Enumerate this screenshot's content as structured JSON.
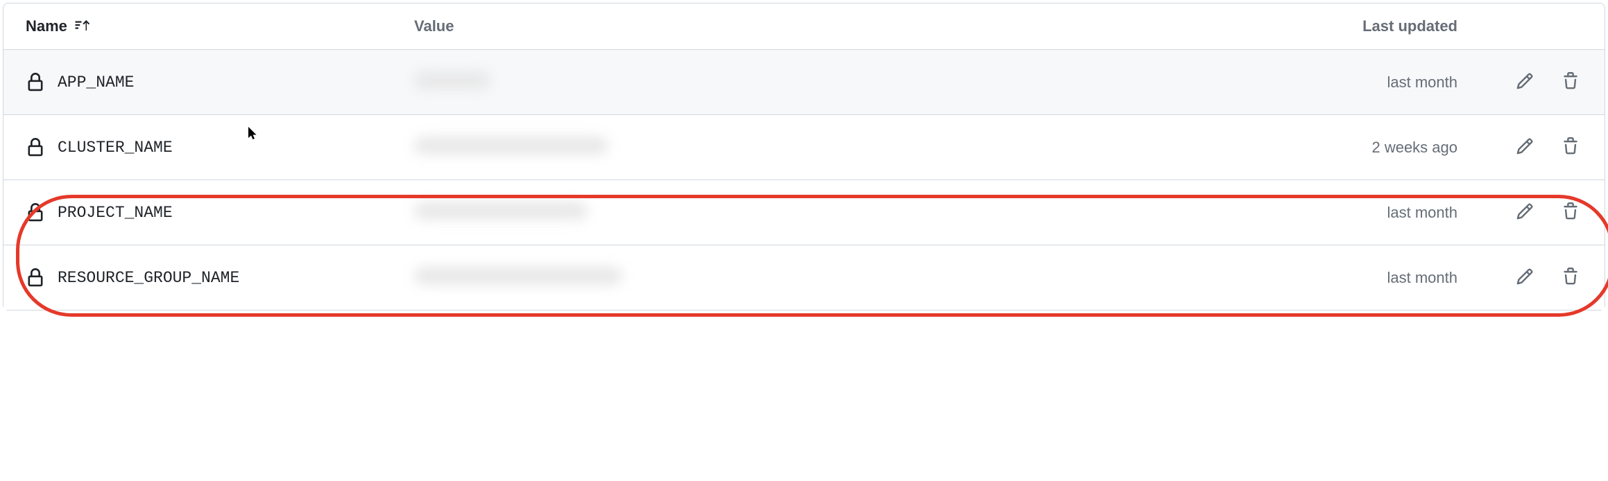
{
  "headers": {
    "name": "Name",
    "value": "Value",
    "updated": "Last updated"
  },
  "rows": [
    {
      "name": "APP_NAME",
      "value_width": "110px",
      "updated": "last month",
      "highlighted": true
    },
    {
      "name": "CLUSTER_NAME",
      "value_width": "280px",
      "updated": "2 weeks ago",
      "highlighted": false
    },
    {
      "name": "PROJECT_NAME",
      "value_width": "250px",
      "updated": "last month",
      "highlighted": false
    },
    {
      "name": "RESOURCE_GROUP_NAME",
      "value_width": "300px",
      "updated": "last month",
      "highlighted": false
    }
  ]
}
